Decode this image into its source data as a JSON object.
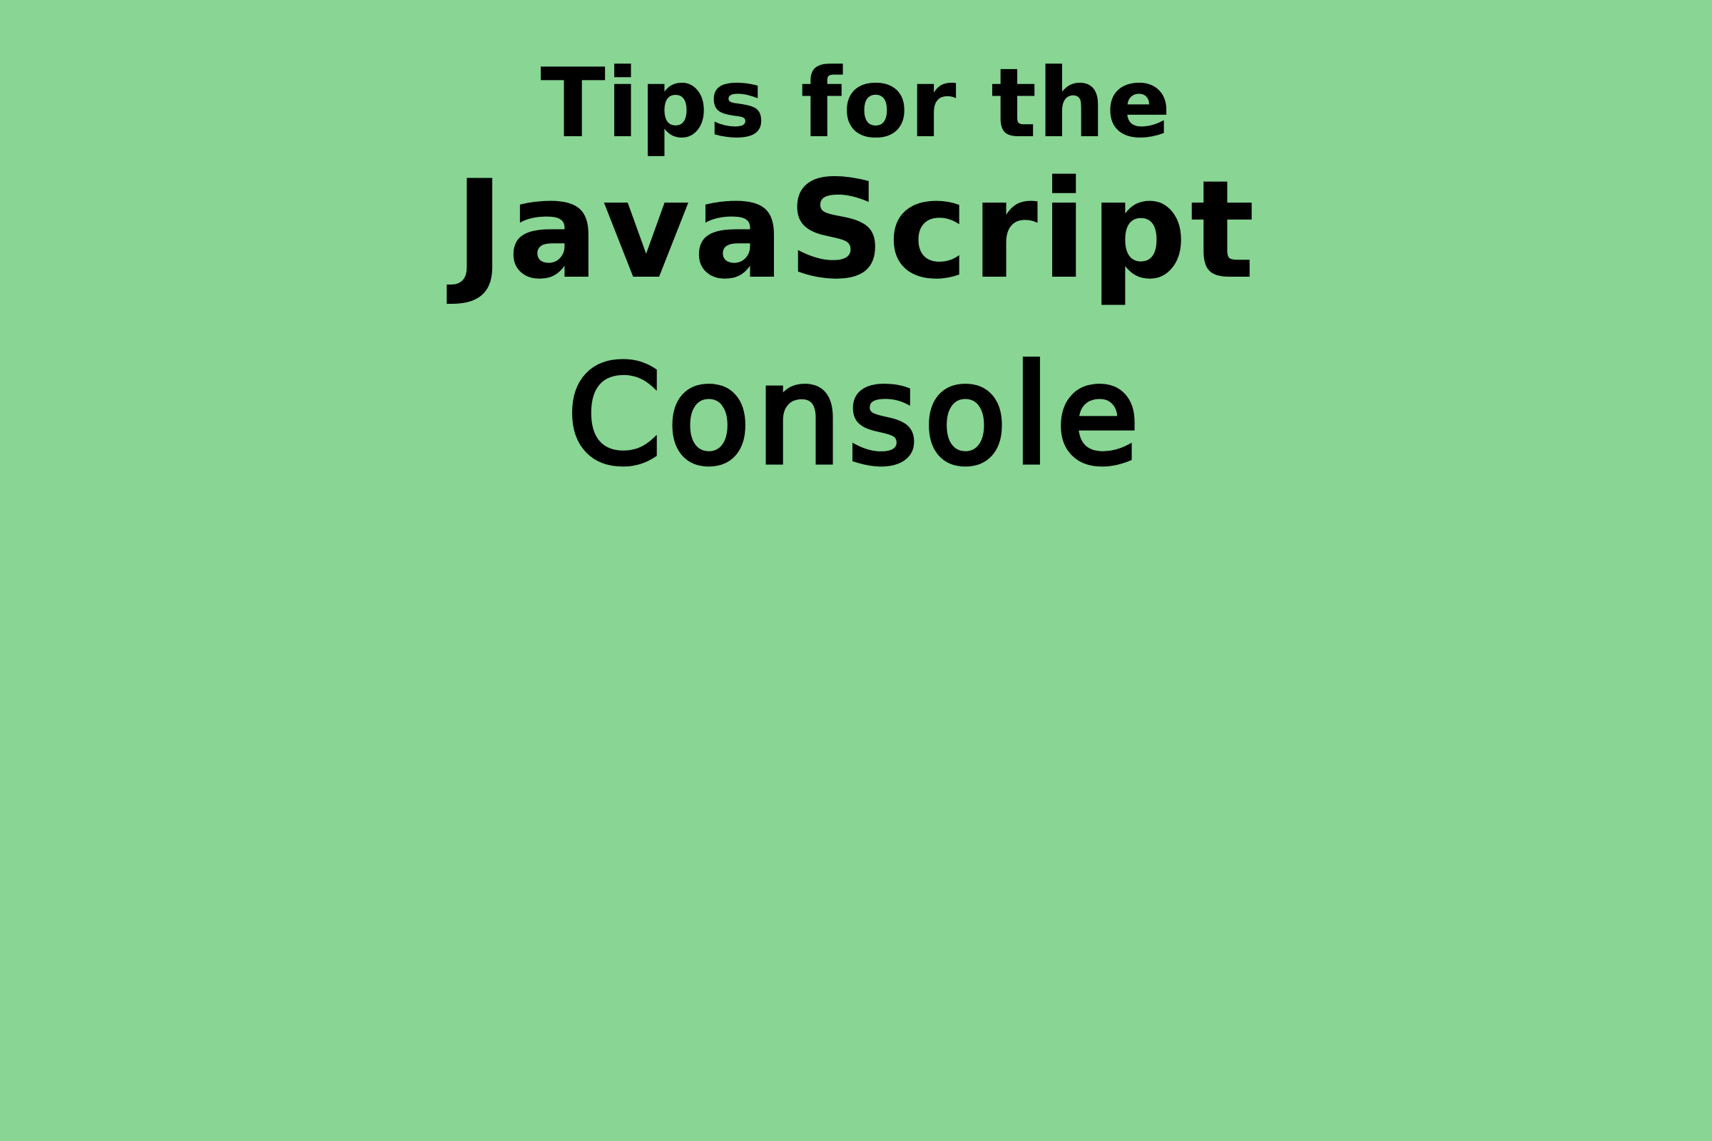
{
  "background_color": "#88d594",
  "text_color": "#000000",
  "title": {
    "line1": "Tips for the",
    "line2": "JavaScript",
    "line3": "Console"
  }
}
